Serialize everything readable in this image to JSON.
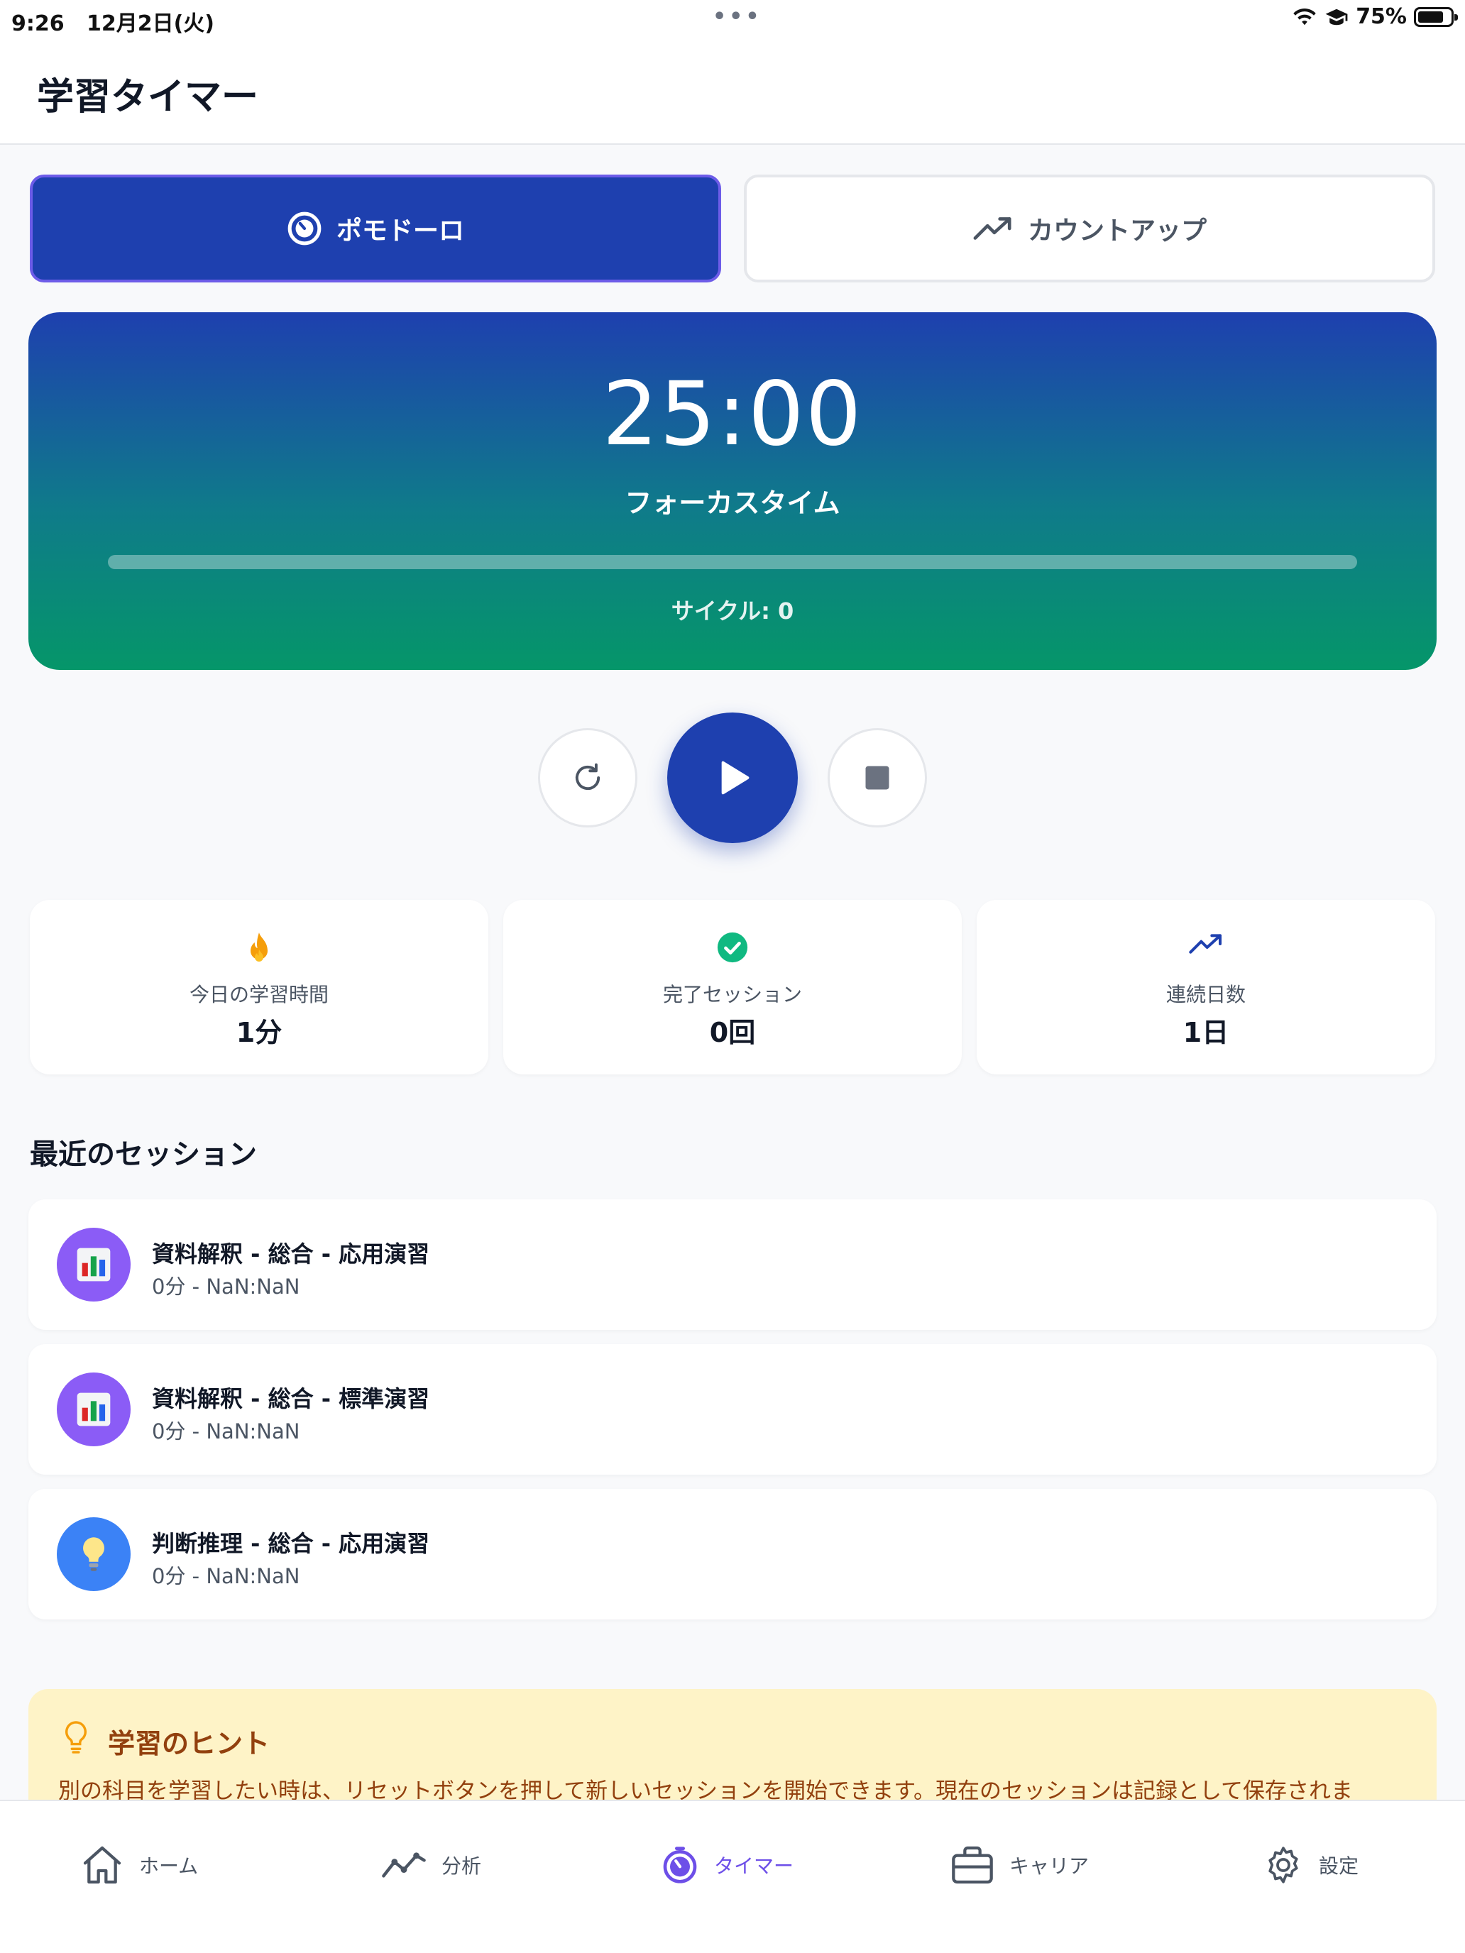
{
  "status_bar": {
    "time": "9:26",
    "date": "12月2日(火)",
    "dots": "•••",
    "battery": "75%"
  },
  "header": {
    "title": "学習タイマー"
  },
  "modes": [
    {
      "label": "ポモドーロ",
      "icon": "timer-icon",
      "active": true
    },
    {
      "label": "カウントアップ",
      "icon": "trending-up-icon",
      "active": false
    }
  ],
  "timer": {
    "time": "25:00",
    "label": "フォーカスタイム",
    "progress": 0,
    "cycle": "サイクル: 0"
  },
  "stats": [
    {
      "icon": "flame-icon",
      "name": "今日の学習時間",
      "value": "1分"
    },
    {
      "icon": "check-circle-icon",
      "name": "完了セッション",
      "value": "0回"
    },
    {
      "icon": "trending-up-icon",
      "name": "連続日数",
      "value": "1日"
    }
  ],
  "recent": {
    "title": "最近のセッション",
    "items": [
      {
        "title": "資料解釈 - 総合 - 応用演習",
        "sub": "0分 - NaN:NaN",
        "icon": "bar-chart-icon"
      },
      {
        "title": "資料解釈 - 総合 - 標準演習",
        "sub": "0分 - NaN:NaN",
        "icon": "bar-chart-icon"
      },
      {
        "title": "判断推理 - 総合 - 応用演習",
        "sub": "0分 - NaN:NaN",
        "icon": "lightbulb-icon"
      }
    ]
  },
  "tips": {
    "title": "学習のヒント",
    "body": "別の科目を学習したい時は、リセットボタンを押して新しいセッションを開始できます。現在のセッションは記録として保存されま"
  },
  "tabs": [
    {
      "label": "ホーム",
      "icon": "home-icon"
    },
    {
      "label": "分析",
      "icon": "analytics-icon"
    },
    {
      "label": "タイマー",
      "icon": "timer-icon",
      "active": true
    },
    {
      "label": "キャリア",
      "icon": "briefcase-icon"
    },
    {
      "label": "設定",
      "icon": "gear-icon"
    }
  ],
  "colors": {
    "primary": "#1e40af",
    "accent": "#6d4fe8",
    "success": "#10b981",
    "flame": "#f59e0b",
    "tip_bg": "#fef3c7",
    "tip_text": "#92400e"
  }
}
